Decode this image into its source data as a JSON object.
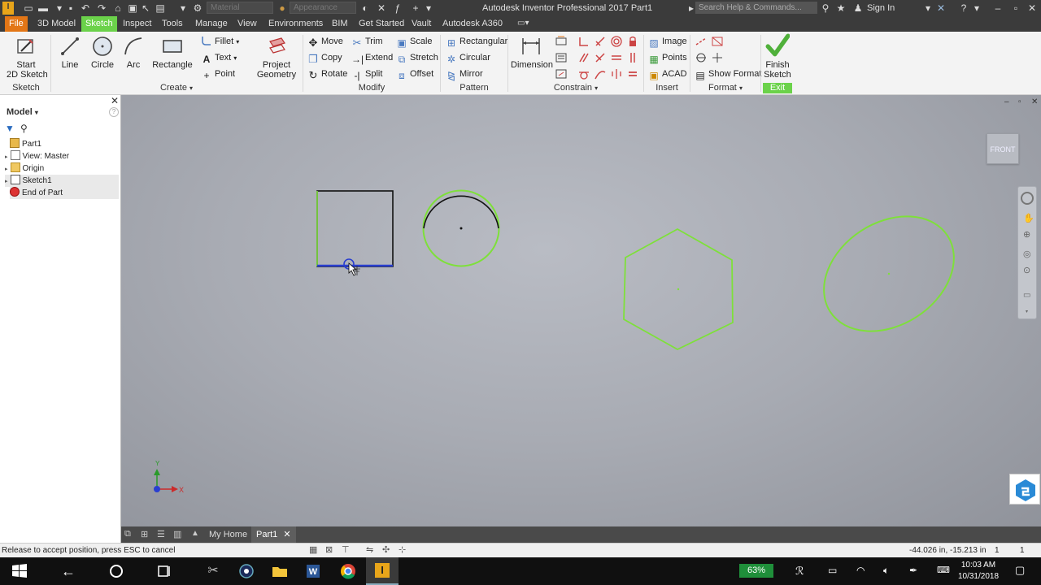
{
  "titlebar": {
    "title": "Autodesk Inventor Professional 2017   Part1",
    "material_placeholder": "Material",
    "appearance_placeholder": "Appearance",
    "search_placeholder": "Search Help & Commands...",
    "sign_in": "Sign In"
  },
  "tabs": [
    "File",
    "3D Model",
    "Sketch",
    "Inspect",
    "Tools",
    "Manage",
    "View",
    "Environments",
    "BIM",
    "Get Started",
    "Vault",
    "Autodesk A360"
  ],
  "ribbon": {
    "sketch_panel": {
      "start_2d_sketch_line1": "Start",
      "start_2d_sketch_line2": "2D Sketch",
      "label": "Sketch"
    },
    "create_panel": {
      "line": "Line",
      "circle": "Circle",
      "arc": "Arc",
      "rectangle": "Rectangle",
      "fillet": "Fillet",
      "text": "Text",
      "point": "Point",
      "project_line1": "Project",
      "project_line2": "Geometry",
      "label": "Create"
    },
    "modify_panel": {
      "move": "Move",
      "copy": "Copy",
      "rotate": "Rotate",
      "trim": "Trim",
      "extend": "Extend",
      "split": "Split",
      "scale": "Scale",
      "stretch": "Stretch",
      "offset": "Offset",
      "label": "Modify"
    },
    "pattern_panel": {
      "rectangular": "Rectangular",
      "circular": "Circular",
      "mirror": "Mirror",
      "label": "Pattern"
    },
    "constrain_panel": {
      "dimension": "Dimension",
      "label": "Constrain"
    },
    "insert_panel": {
      "image": "Image",
      "points": "Points",
      "acad": "ACAD",
      "label": "Insert"
    },
    "format_panel": {
      "show_format": "Show Format",
      "label": "Format"
    },
    "exit_panel": {
      "finish_line1": "Finish",
      "finish_line2": "Sketch",
      "label": "Exit"
    }
  },
  "browser": {
    "header": "Model",
    "items": [
      "Part1",
      "View: Master",
      "Origin",
      "Sketch1",
      "End of Part"
    ]
  },
  "viewcube": {
    "face": "FRONT"
  },
  "triad": {
    "x": "X",
    "y": "Y"
  },
  "doctabs": {
    "home": "My Home",
    "part": "Part1"
  },
  "status": {
    "message": "Release to accept position, press ESC to cancel",
    "coords": "-44.026 in, -15.213 in",
    "count1": "1",
    "count2": "1"
  },
  "taskbar": {
    "battery": "63%",
    "time": "10:03 AM",
    "date": "10/31/2018"
  },
  "colors": {
    "file_tab": "#e37616",
    "active_tab": "#6bd24a",
    "sketch_green": "#7ee03a",
    "ribbon_bg": "#f3f3f3"
  }
}
